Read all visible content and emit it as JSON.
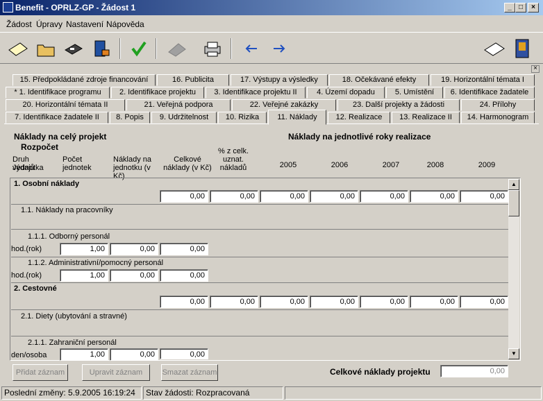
{
  "window": {
    "title": "Benefit - OPRLZ-GP - Žádost 1",
    "minimize": "_",
    "maximize": "□",
    "close": "×"
  },
  "menu": [
    "Žádost",
    "Úpravy",
    "Nastavení",
    "Nápověda"
  ],
  "tabs": {
    "row1": [
      "15. Předpokládané zdroje financování",
      "16. Publicita",
      "17. Výstupy a výsledky",
      "18. Očekávané efekty",
      "19. Horizontální témata I"
    ],
    "row2": [
      "* 1. Identifikace programu",
      "2. Identifikace projektu",
      "3. Identifikace projektu II",
      "4. Území dopadu",
      "5. Umístění",
      "6. Identifikace žadatele"
    ],
    "row3": [
      "20. Horizontální témata II",
      "21. Veřejná podpora",
      "22. Veřejné zakázky",
      "23. Další projekty a žádosti",
      "24. Přílohy"
    ],
    "row4": [
      "7. Identifikace žadatele II",
      "8. Popis",
      "9. Udržitelnost",
      "10. Rizika",
      "11. Náklady",
      "12. Realizace",
      "13. Realizace II",
      "14. Harmonogram"
    ]
  },
  "header": {
    "section_left": "Náklady na celý projekt",
    "section_right": "Náklady na jednotlivé roky realizace",
    "rozpocet": "Rozpočet",
    "col_druh": "Druh výdajů",
    "col_jednotka": "Jednotka",
    "col_pocet": "Počet jednotek",
    "col_naklady_jedn": "Náklady na jednotku (v Kč)",
    "col_celkove": "Celkové náklady (v Kč)",
    "col_pct": "% z celk. uznat. nákladů",
    "years": [
      "2005",
      "2006",
      "2007",
      "2008",
      "2009"
    ]
  },
  "rows": {
    "sec1": {
      "title": "1. Osobní náklady",
      "values": [
        "0,00",
        "0,00",
        "0,00",
        "0,00",
        "0,00",
        "0,00",
        "0,00"
      ]
    },
    "sub11": {
      "title": "1.1. Náklady na pracovníky"
    },
    "sub111": {
      "title": "1.1.1. Odborný personál",
      "unit": "hod.(rok)",
      "values": [
        "1,00",
        "0,00",
        "0,00"
      ]
    },
    "sub112": {
      "title": "1.1.2. Administrativní/pomocný personál",
      "unit": "hod.(rok)",
      "values": [
        "1,00",
        "0,00",
        "0,00"
      ]
    },
    "sec2": {
      "title": "2. Cestovné",
      "values": [
        "0,00",
        "0,00",
        "0,00",
        "0,00",
        "0,00",
        "0,00",
        "0,00"
      ]
    },
    "sub21": {
      "title": "2.1. Diety (ubytování a stravné)"
    },
    "sub211": {
      "title": "2.1.1. Zahraniční personál",
      "unit": "den/osoba",
      "values": [
        "1,00",
        "0,00",
        "0,00"
      ]
    }
  },
  "buttons": {
    "add": "Přidat záznam",
    "edit": "Upravit záznam",
    "delete": "Smazat záznam"
  },
  "total": {
    "label": "Celkové náklady projektu",
    "value": "0,00"
  },
  "status": {
    "changes": "Poslední změny: 5.9.2005 16:19:24",
    "state": "Stav žádosti: Rozpracovaná"
  }
}
